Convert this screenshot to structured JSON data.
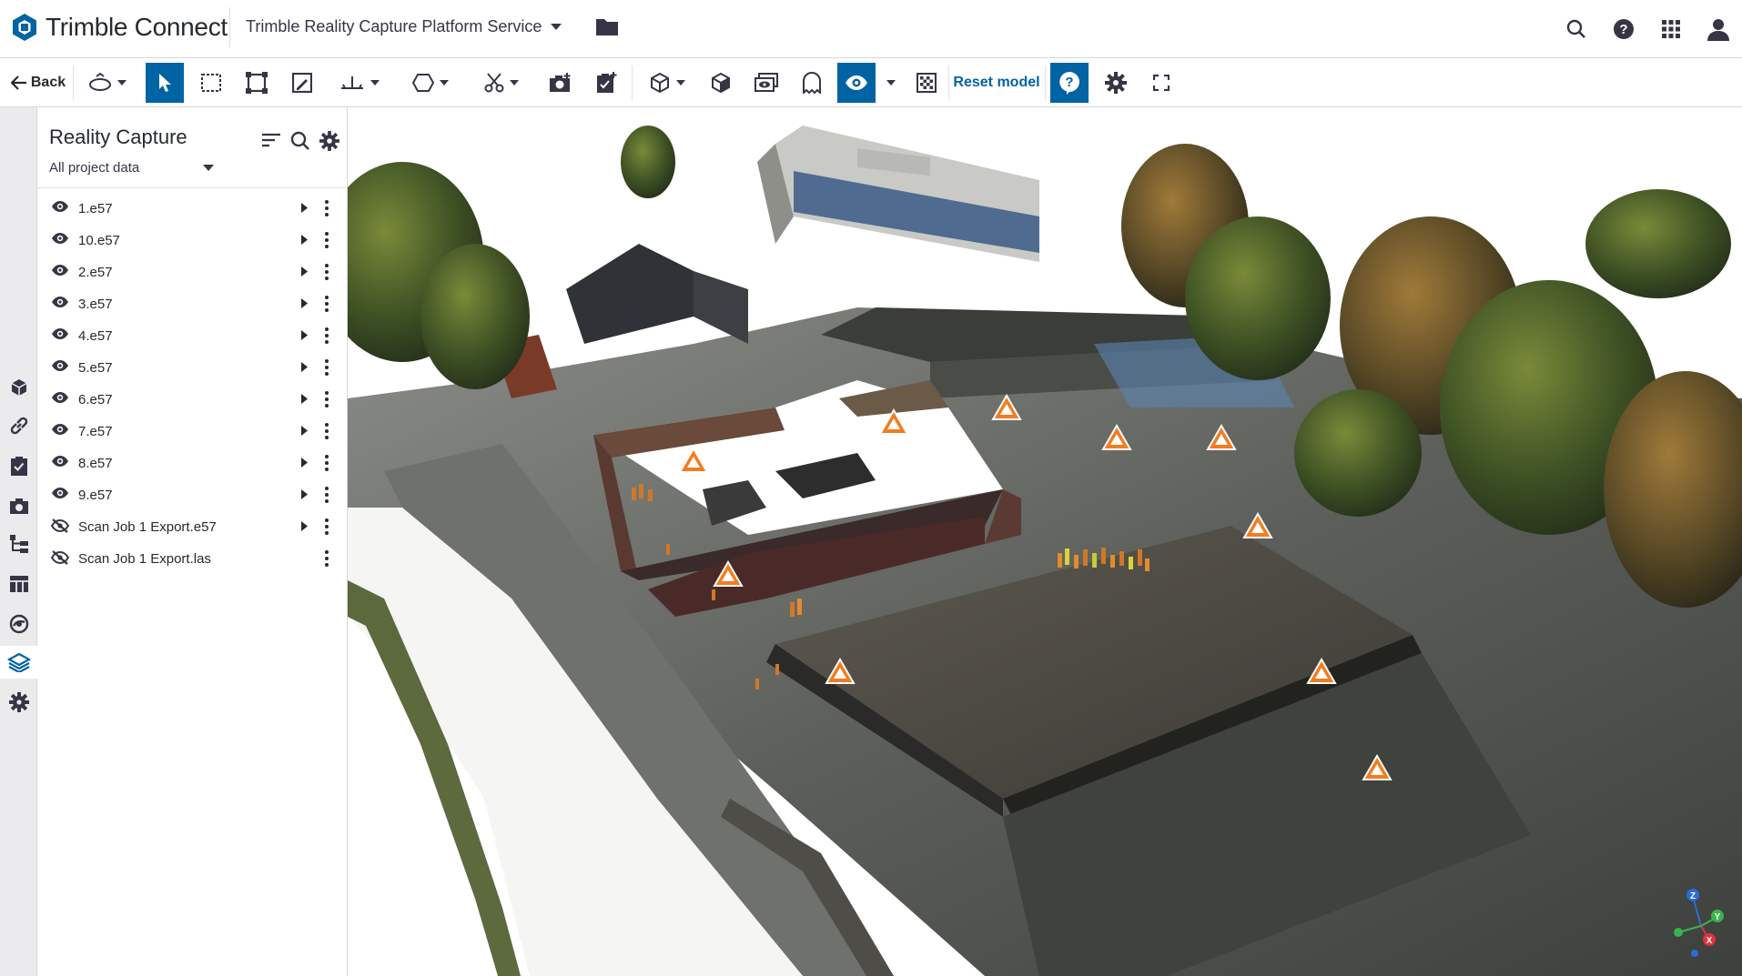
{
  "header": {
    "logo_text": "Trimble Connect",
    "project_name": "Trimble Reality Capture Platform Service"
  },
  "toolbar": {
    "back_label": "Back",
    "reset_label": "Reset model",
    "accent_color": "#0063a3"
  },
  "panel": {
    "title": "Reality Capture",
    "filter_label": "All project data",
    "items": [
      {
        "label": "1.e57",
        "visible": true,
        "expandable": true
      },
      {
        "label": "10.e57",
        "visible": true,
        "expandable": true
      },
      {
        "label": "2.e57",
        "visible": true,
        "expandable": true
      },
      {
        "label": "3.e57",
        "visible": true,
        "expandable": true
      },
      {
        "label": "4.e57",
        "visible": true,
        "expandable": true
      },
      {
        "label": "5.e57",
        "visible": true,
        "expandable": true
      },
      {
        "label": "6.e57",
        "visible": true,
        "expandable": true
      },
      {
        "label": "7.e57",
        "visible": true,
        "expandable": true
      },
      {
        "label": "8.e57",
        "visible": true,
        "expandable": true
      },
      {
        "label": "9.e57",
        "visible": true,
        "expandable": true
      },
      {
        "label": "Scan Job 1 Export.e57",
        "visible": false,
        "expandable": true
      },
      {
        "label": "Scan Job 1 Export.las",
        "visible": false,
        "expandable": false
      }
    ]
  },
  "rail": {
    "items": [
      "models-icon",
      "links-icon",
      "todo-icon",
      "views-icon",
      "hierarchy-icon",
      "table-icon",
      "extension-icon",
      "reality-capture-icon",
      "plugin-gear-icon"
    ],
    "active": "reality-capture-icon"
  },
  "viewport": {
    "marker_color": "#f47b20",
    "axis_labels": {
      "z": "Z",
      "y": "Y",
      "x": "X"
    }
  }
}
